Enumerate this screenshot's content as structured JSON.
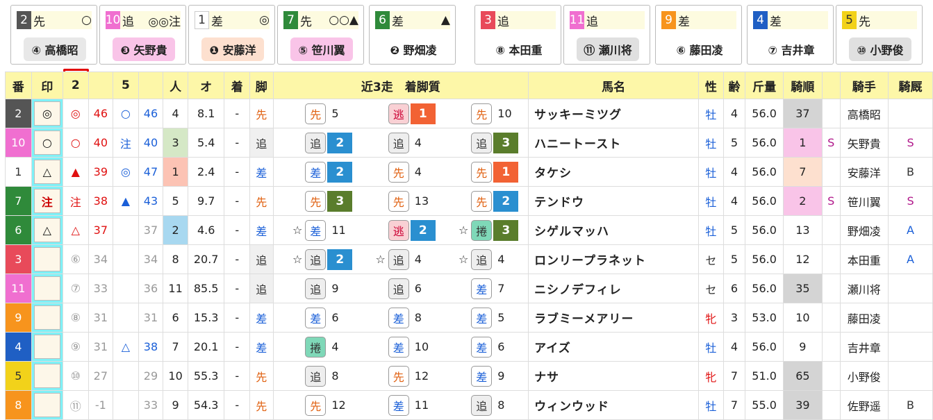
{
  "cards": [
    {
      "num": "2",
      "num_color": "#555555",
      "style": "先",
      "sym": "○",
      "jockey": "④ 高橋昭",
      "pill_bg": "#e8e8e8",
      "pill_color": "#222222"
    },
    {
      "num": "10",
      "num_color": "#f06fd0",
      "style": "追",
      "sym": "◎◎注",
      "jockey": "❸ 矢野貴",
      "pill_bg": "#f9c4e8",
      "pill_color": "#222222"
    },
    {
      "num": "1",
      "num_color": "#ffffff",
      "num_text": "#333333",
      "style": "差",
      "sym": "◎",
      "jockey": "❶ 安藤洋",
      "pill_bg": "#fde0cf",
      "pill_color": "#222222"
    },
    {
      "num": "7",
      "num_color": "#2f8a3a",
      "style": "先",
      "sym": "○○▲",
      "jockey": "⑤ 笹川翼",
      "pill_bg": "#f9c4e8",
      "pill_color": "#222222"
    },
    {
      "num": "6",
      "num_color": "#2f8a3a",
      "style": "差",
      "sym": "▲",
      "jockey": "❷ 野畑凌",
      "pill_bg": "#ffffff",
      "pill_color": "#222222"
    },
    {
      "num": "3",
      "num_color": "#e84a5a",
      "style": "追",
      "sym": "",
      "jockey": "⑧ 本田重",
      "pill_bg": "#ffffff",
      "pill_color": "#222222"
    },
    {
      "num": "11",
      "num_color": "#f06fd0",
      "style": "追",
      "sym": "",
      "jockey": "⑪ 瀬川将",
      "pill_bg": "#e0e0e0",
      "pill_color": "#222222"
    },
    {
      "num": "9",
      "num_color": "#f7941d",
      "style": "差",
      "sym": "",
      "jockey": "⑥ 藤田凌",
      "pill_bg": "#ffffff",
      "pill_color": "#222222"
    },
    {
      "num": "4",
      "num_color": "#1f5fc4",
      "style": "差",
      "sym": "",
      "jockey": "⑦ 吉井章",
      "pill_bg": "#ffffff",
      "pill_color": "#222222"
    },
    {
      "num": "5",
      "num_color": "#f2d21a",
      "num_text": "#333333",
      "style": "先",
      "sym": "",
      "jockey": "⑩ 小野俊",
      "pill_bg": "#e0e0e0",
      "pill_color": "#222222"
    }
  ],
  "headers": {
    "ban": "番",
    "shirushi": "印",
    "c2": "2",
    "c5": "5",
    "ninki": "人",
    "odds": "オ",
    "chaku": "着",
    "ashi": "脚",
    "recent": "近3走　着脚質",
    "horse": "馬名",
    "sex": "性",
    "age": "齢",
    "weight": "斤量",
    "kijun": "騎順",
    "jockey": "騎手",
    "kikyu": "騎厩"
  },
  "rows": [
    {
      "ban": "2",
      "ban_color": "#555555",
      "mark": "◎",
      "mark_box": false,
      "s2": "◎",
      "s2c": "red",
      "v2": "46",
      "v2c": "red",
      "s5": "○",
      "s5c": "blue",
      "v5": "46",
      "v5c": "blue",
      "ninki": "4",
      "ninki_bg": "",
      "odds": "8.1",
      "chaku": "-",
      "ashi": "先",
      "ashi_c": "org",
      "ashi_bg": "",
      "recent": [
        {
          "star": "",
          "leg": "先",
          "lc": "org",
          "lb": "#fff",
          "lbd": "#999",
          "pos": "5",
          "pb": ""
        },
        {
          "star": "",
          "leg": "逃",
          "lc": "#c03",
          "lb": "#f9d0d4",
          "lbd": "#999",
          "pos": "1",
          "pb": "#f26234"
        },
        {
          "star": "",
          "leg": "先",
          "lc": "org",
          "lb": "#fff",
          "lbd": "#999",
          "pos": "10",
          "pb": ""
        }
      ],
      "horse": "サッキーミツグ",
      "sex": "牡",
      "sexc": "blue",
      "age": "4",
      "weight": "56.0",
      "kijun": "37",
      "kij_bg": "#d4d4d4",
      "s": "",
      "jockey": "高橋昭",
      "kikyu": "",
      "kikyu_c": "gd"
    },
    {
      "ban": "10",
      "ban_color": "#f06fd0",
      "mark": "○",
      "mark_box": false,
      "s2": "○",
      "s2c": "red",
      "v2": "40",
      "v2c": "red",
      "s5": "注",
      "s5c": "blue",
      "v5": "40",
      "v5c": "blue",
      "ninki": "3",
      "ninki_bg": "#d5e8c6",
      "odds": "5.4",
      "chaku": "-",
      "ashi": "追",
      "ashi_c": "gd",
      "ashi_bg": "#f0f0f0",
      "recent": [
        {
          "star": "",
          "leg": "追",
          "lc": "gd",
          "lb": "#eee",
          "lbd": "#999",
          "pos": "2",
          "pb": "#2a8fd0"
        },
        {
          "star": "",
          "leg": "追",
          "lc": "gd",
          "lb": "#eee",
          "lbd": "#999",
          "pos": "4",
          "pb": ""
        },
        {
          "star": "",
          "leg": "追",
          "lc": "gd",
          "lb": "#eee",
          "lbd": "#999",
          "pos": "3",
          "pb": "#5a7d2c"
        }
      ],
      "horse": "ハニートースト",
      "sex": "牡",
      "sexc": "blue",
      "age": "5",
      "weight": "56.0",
      "kijun": "1",
      "kij_bg": "#f9c4e8",
      "s": "S",
      "jockey": "矢野貴",
      "kikyu": "S",
      "kikyu_c": "purple"
    },
    {
      "ban": "1",
      "ban_color": "#ffffff",
      "mark": "△",
      "mark_box": false,
      "s2": "▲",
      "s2c": "red",
      "v2": "39",
      "v2c": "red",
      "s5": "◎",
      "s5c": "blue",
      "v5": "47",
      "v5c": "blue",
      "ninki": "1",
      "ninki_bg": "#fcc3b4",
      "odds": "2.4",
      "chaku": "-",
      "ashi": "差",
      "ashi_c": "blue",
      "ashi_bg": "",
      "recent": [
        {
          "star": "",
          "leg": "差",
          "lc": "blue",
          "lb": "#fff",
          "lbd": "#999",
          "pos": "2",
          "pb": "#2a8fd0"
        },
        {
          "star": "",
          "leg": "先",
          "lc": "org",
          "lb": "#fff",
          "lbd": "#999",
          "pos": "4",
          "pb": ""
        },
        {
          "star": "",
          "leg": "先",
          "lc": "org",
          "lb": "#fff",
          "lbd": "#999",
          "pos": "1",
          "pb": "#f26234"
        }
      ],
      "horse": "タケシ",
      "sex": "牡",
      "sexc": "blue",
      "age": "4",
      "weight": "56.0",
      "kijun": "7",
      "kij_bg": "#fde0cf",
      "s": "",
      "jockey": "安藤洋",
      "kikyu": "B",
      "kikyu_c": "gd"
    },
    {
      "ban": "7",
      "ban_color": "#2f8a3a",
      "mark": "注",
      "mark_box": false,
      "s2": "注",
      "s2c": "red",
      "v2": "38",
      "v2c": "red",
      "s5": "▲",
      "s5c": "blue",
      "v5": "43",
      "v5c": "blue",
      "ninki": "5",
      "ninki_bg": "",
      "odds": "9.7",
      "chaku": "-",
      "ashi": "先",
      "ashi_c": "org",
      "ashi_bg": "",
      "recent": [
        {
          "star": "",
          "leg": "先",
          "lc": "org",
          "lb": "#fff",
          "lbd": "#999",
          "pos": "3",
          "pb": "#5a7d2c"
        },
        {
          "star": "",
          "leg": "先",
          "lc": "org",
          "lb": "#fff",
          "lbd": "#999",
          "pos": "13",
          "pb": ""
        },
        {
          "star": "",
          "leg": "先",
          "lc": "org",
          "lb": "#fff",
          "lbd": "#999",
          "pos": "2",
          "pb": "#2a8fd0"
        }
      ],
      "horse": "テンドウ",
      "sex": "牡",
      "sexc": "blue",
      "age": "4",
      "weight": "56.0",
      "kijun": "2",
      "kij_bg": "#f9c4e8",
      "s": "S",
      "jockey": "笹川翼",
      "kikyu": "S",
      "kikyu_c": "purple"
    },
    {
      "ban": "6",
      "ban_color": "#2f8a3a",
      "mark": "△",
      "mark_box": false,
      "s2": "△",
      "s2c": "red",
      "v2": "37",
      "v2c": "red",
      "s5": "",
      "s5c": "gray",
      "v5": "37",
      "v5c": "gray",
      "ninki": "2",
      "ninki_bg": "#a8d8f0",
      "odds": "4.6",
      "chaku": "-",
      "ashi": "差",
      "ashi_c": "blue",
      "ashi_bg": "",
      "recent": [
        {
          "star": "☆",
          "leg": "差",
          "lc": "blue",
          "lb": "#fff",
          "lbd": "#999",
          "pos": "11",
          "pb": ""
        },
        {
          "star": "",
          "leg": "逃",
          "lc": "#c03",
          "lb": "#f9d0d4",
          "lbd": "#999",
          "pos": "2",
          "pb": "#2a8fd0"
        },
        {
          "star": "☆",
          "leg": "捲",
          "lc": "gd",
          "lb": "#7fd8b8",
          "lbd": "#999",
          "pos": "3",
          "pb": "#5a7d2c"
        }
      ],
      "horse": "シゲルマッハ",
      "sex": "牡",
      "sexc": "blue",
      "age": "5",
      "weight": "56.0",
      "kijun": "13",
      "kij_bg": "",
      "s": "",
      "jockey": "野畑凌",
      "kikyu": "A",
      "kikyu_c": "blue"
    },
    {
      "ban": "3",
      "ban_color": "#e84a5a",
      "mark": "",
      "mark_box": true,
      "s2": "⑥",
      "s2c": "gray",
      "v2": "34",
      "v2c": "gray",
      "s5": "",
      "s5c": "gray",
      "v5": "34",
      "v5c": "gray",
      "ninki": "8",
      "ninki_bg": "",
      "odds": "20.7",
      "chaku": "-",
      "ashi": "追",
      "ashi_c": "gd",
      "ashi_bg": "#f0f0f0",
      "recent": [
        {
          "star": "☆",
          "leg": "追",
          "lc": "gd",
          "lb": "#eee",
          "lbd": "#999",
          "pos": "2",
          "pb": "#2a8fd0"
        },
        {
          "star": "☆",
          "leg": "追",
          "lc": "gd",
          "lb": "#eee",
          "lbd": "#999",
          "pos": "4",
          "pb": ""
        },
        {
          "star": "☆",
          "leg": "追",
          "lc": "gd",
          "lb": "#eee",
          "lbd": "#999",
          "pos": "4",
          "pb": ""
        }
      ],
      "horse": "ロンリープラネット",
      "sex": "セ",
      "sexc": "gd",
      "age": "5",
      "weight": "56.0",
      "kijun": "12",
      "kij_bg": "",
      "s": "",
      "jockey": "本田重",
      "kikyu": "A",
      "kikyu_c": "blue"
    },
    {
      "ban": "11",
      "ban_color": "#f06fd0",
      "mark": "",
      "mark_box": true,
      "s2": "⑦",
      "s2c": "gray",
      "v2": "33",
      "v2c": "gray",
      "s5": "",
      "s5c": "gray",
      "v5": "36",
      "v5c": "gray",
      "ninki": "11",
      "ninki_bg": "",
      "odds": "85.5",
      "chaku": "-",
      "ashi": "追",
      "ashi_c": "gd",
      "ashi_bg": "#f0f0f0",
      "recent": [
        {
          "star": "",
          "leg": "追",
          "lc": "gd",
          "lb": "#eee",
          "lbd": "#999",
          "pos": "9",
          "pb": ""
        },
        {
          "star": "",
          "leg": "追",
          "lc": "gd",
          "lb": "#eee",
          "lbd": "#999",
          "pos": "6",
          "pb": ""
        },
        {
          "star": "",
          "leg": "差",
          "lc": "blue",
          "lb": "#fff",
          "lbd": "#999",
          "pos": "7",
          "pb": ""
        }
      ],
      "horse": "ニシノデフィレ",
      "sex": "セ",
      "sexc": "gd",
      "age": "6",
      "weight": "56.0",
      "kijun": "35",
      "kij_bg": "#d4d4d4",
      "s": "",
      "jockey": "瀬川将",
      "kikyu": "",
      "kikyu_c": "gd"
    },
    {
      "ban": "9",
      "ban_color": "#f7941d",
      "mark": "",
      "mark_box": true,
      "s2": "⑧",
      "s2c": "gray",
      "v2": "31",
      "v2c": "gray",
      "s5": "",
      "s5c": "gray",
      "v5": "31",
      "v5c": "gray",
      "ninki": "6",
      "ninki_bg": "",
      "odds": "15.3",
      "chaku": "-",
      "ashi": "差",
      "ashi_c": "blue",
      "ashi_bg": "",
      "recent": [
        {
          "star": "",
          "leg": "差",
          "lc": "blue",
          "lb": "#fff",
          "lbd": "#999",
          "pos": "6",
          "pb": ""
        },
        {
          "star": "",
          "leg": "差",
          "lc": "blue",
          "lb": "#fff",
          "lbd": "#999",
          "pos": "8",
          "pb": ""
        },
        {
          "star": "",
          "leg": "差",
          "lc": "blue",
          "lb": "#fff",
          "lbd": "#999",
          "pos": "5",
          "pb": ""
        }
      ],
      "horse": "ラブミーメアリー",
      "sex": "牝",
      "sexc": "red",
      "age": "3",
      "weight": "53.0",
      "kijun": "10",
      "kij_bg": "",
      "s": "",
      "jockey": "藤田凌",
      "kikyu": "",
      "kikyu_c": "gd"
    },
    {
      "ban": "4",
      "ban_color": "#1f5fc4",
      "mark": "",
      "mark_box": true,
      "s2": "⑨",
      "s2c": "gray",
      "v2": "31",
      "v2c": "gray",
      "s5": "△",
      "s5c": "blue",
      "v5": "38",
      "v5c": "blue",
      "ninki": "7",
      "ninki_bg": "",
      "odds": "20.1",
      "chaku": "-",
      "ashi": "差",
      "ashi_c": "blue",
      "ashi_bg": "",
      "recent": [
        {
          "star": "",
          "leg": "捲",
          "lc": "gd",
          "lb": "#7fd8b8",
          "lbd": "#999",
          "pos": "4",
          "pb": ""
        },
        {
          "star": "",
          "leg": "差",
          "lc": "blue",
          "lb": "#fff",
          "lbd": "#999",
          "pos": "10",
          "pb": ""
        },
        {
          "star": "",
          "leg": "差",
          "lc": "blue",
          "lb": "#fff",
          "lbd": "#999",
          "pos": "6",
          "pb": ""
        }
      ],
      "horse": "アイズ",
      "sex": "牡",
      "sexc": "blue",
      "age": "4",
      "weight": "56.0",
      "kijun": "9",
      "kij_bg": "",
      "s": "",
      "jockey": "吉井章",
      "kikyu": "",
      "kikyu_c": "gd"
    },
    {
      "ban": "5",
      "ban_color": "#f2d21a",
      "mark": "",
      "mark_box": true,
      "s2": "⑩",
      "s2c": "gray",
      "v2": "27",
      "v2c": "gray",
      "s5": "",
      "s5c": "gray",
      "v5": "29",
      "v5c": "gray",
      "ninki": "10",
      "ninki_bg": "",
      "odds": "55.3",
      "chaku": "-",
      "ashi": "先",
      "ashi_c": "org",
      "ashi_bg": "",
      "recent": [
        {
          "star": "",
          "leg": "追",
          "lc": "gd",
          "lb": "#eee",
          "lbd": "#999",
          "pos": "8",
          "pb": ""
        },
        {
          "star": "",
          "leg": "先",
          "lc": "org",
          "lb": "#fff",
          "lbd": "#999",
          "pos": "12",
          "pb": ""
        },
        {
          "star": "",
          "leg": "差",
          "lc": "blue",
          "lb": "#fff",
          "lbd": "#999",
          "pos": "9",
          "pb": ""
        }
      ],
      "horse": "ナサ",
      "sex": "牝",
      "sexc": "red",
      "age": "7",
      "weight": "51.0",
      "kijun": "65",
      "kij_bg": "#d4d4d4",
      "s": "",
      "jockey": "小野俊",
      "kikyu": "",
      "kikyu_c": "gd"
    },
    {
      "ban": "8",
      "ban_color": "#f7941d",
      "mark": "",
      "mark_box": true,
      "s2": "⑪",
      "s2c": "gray",
      "v2": "-1",
      "v2c": "gray",
      "s5": "",
      "s5c": "gray",
      "v5": "33",
      "v5c": "gray",
      "ninki": "9",
      "ninki_bg": "",
      "odds": "54.3",
      "chaku": "-",
      "ashi": "先",
      "ashi_c": "org",
      "ashi_bg": "",
      "recent": [
        {
          "star": "",
          "leg": "先",
          "lc": "org",
          "lb": "#fff",
          "lbd": "#999",
          "pos": "12",
          "pb": ""
        },
        {
          "star": "",
          "leg": "差",
          "lc": "blue",
          "lb": "#fff",
          "lbd": "#999",
          "pos": "11",
          "pb": ""
        },
        {
          "star": "",
          "leg": "追",
          "lc": "gd",
          "lb": "#eee",
          "lbd": "#999",
          "pos": "8",
          "pb": ""
        }
      ],
      "horse": "ウィンウッド",
      "sex": "牡",
      "sexc": "blue",
      "age": "7",
      "weight": "55.0",
      "kijun": "39",
      "kij_bg": "#d4d4d4",
      "s": "",
      "jockey": "佐野遥",
      "kikyu": "B",
      "kikyu_c": "gd"
    }
  ]
}
